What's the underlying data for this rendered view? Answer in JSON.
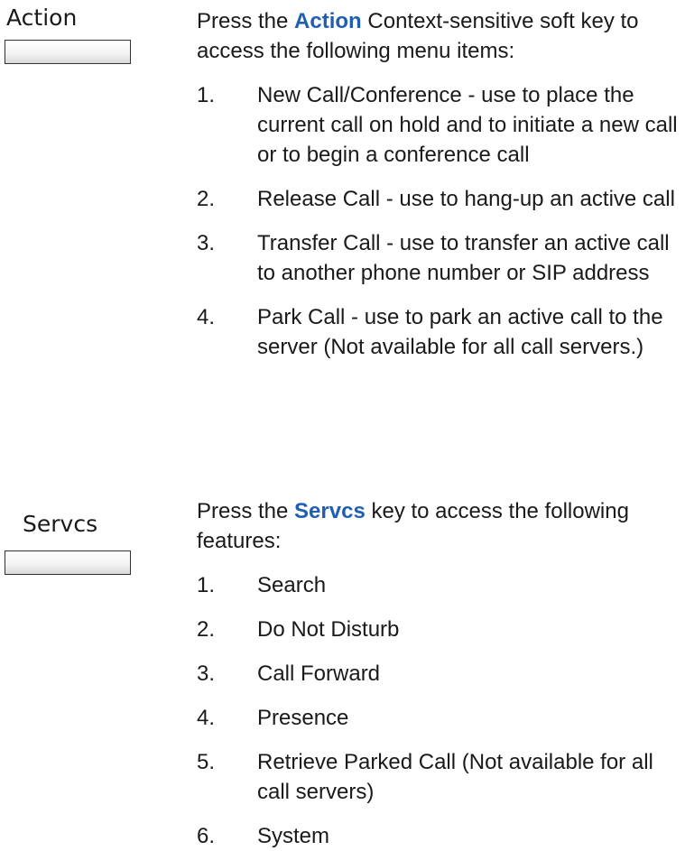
{
  "action": {
    "key_label": "Action",
    "intro_prefix": "Press the ",
    "intro_highlight": "Action",
    "intro_suffix": " Context-sensitive soft key to access the following menu items:",
    "items": [
      {
        "num": "1.",
        "text": "New Call/Conference - use to place the current call on hold and to initiate a new call or to begin a conference call"
      },
      {
        "num": "2.",
        "text": "Release Call - use to hang-up an active call"
      },
      {
        "num": "3.",
        "text": "Transfer Call - use to transfer an active call to another phone number or SIP address"
      },
      {
        "num": "4.",
        "text": "Park Call - use to park an active call to the server (Not available for all call servers.)"
      }
    ]
  },
  "servcs": {
    "key_label": "Servcs",
    "intro_prefix": "Press the ",
    "intro_highlight": "Servcs",
    "intro_suffix": " key to access the following features:",
    "items": [
      {
        "num": "1.",
        "text": "Search"
      },
      {
        "num": "2.",
        "text": "Do Not Disturb"
      },
      {
        "num": "3.",
        "text": "Call Forward"
      },
      {
        "num": "4.",
        "text": "Presence"
      },
      {
        "num": "5.",
        "text": "Retrieve Parked Call (Not available for all call servers)"
      },
      {
        "num": "6.",
        "text": "System"
      }
    ]
  }
}
